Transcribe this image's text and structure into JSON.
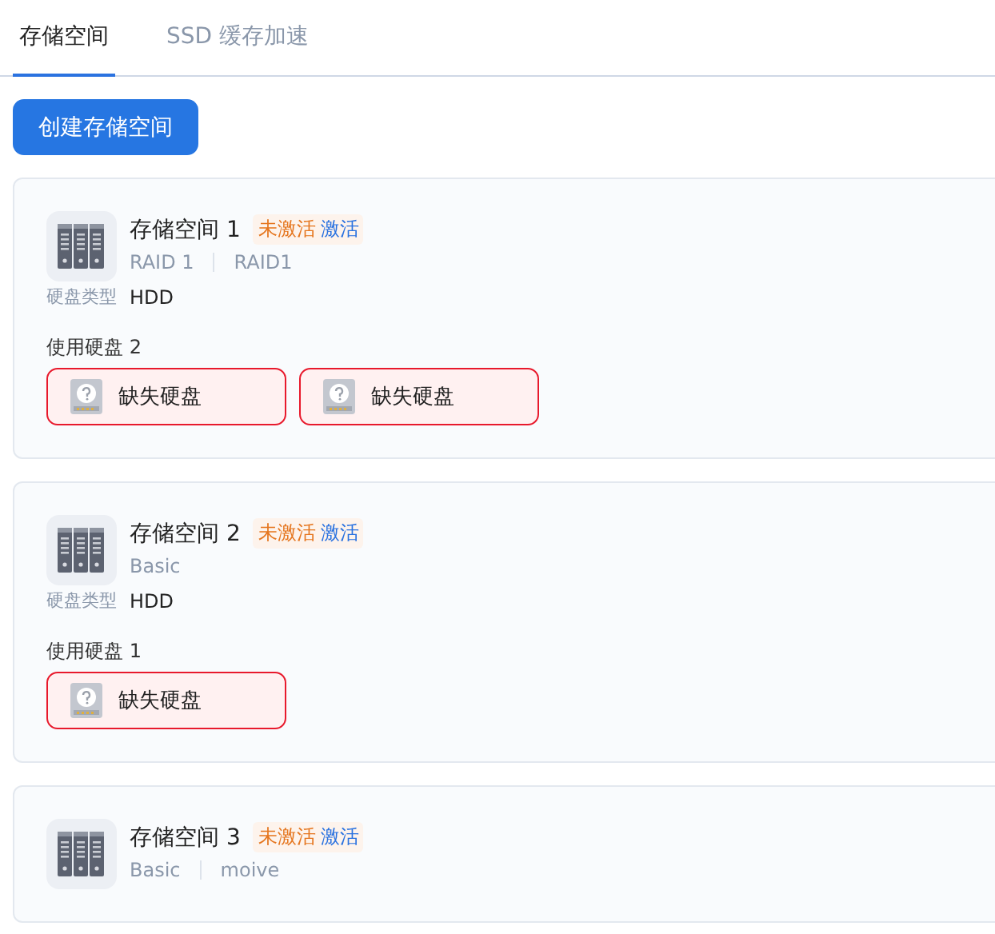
{
  "tabs": [
    {
      "label": "存储空间",
      "selected": true
    },
    {
      "label": "SSD 缓存加速",
      "selected": false
    }
  ],
  "create_button": "创建存储空间",
  "spaces": [
    {
      "name": "存储空间 1",
      "status": "未激活",
      "action": "激活",
      "tags": [
        "RAID 1",
        "RAID1"
      ],
      "disk_type_label": "硬盘类型",
      "disk_type": "HDD",
      "disks_label": "使用硬盘 2",
      "disks": [
        {
          "label": "缺失硬盘",
          "missing": true
        },
        {
          "label": "缺失硬盘",
          "missing": true
        }
      ]
    },
    {
      "name": "存储空间 2",
      "status": "未激活",
      "action": "激活",
      "tags": [
        "Basic"
      ],
      "disk_type_label": "硬盘类型",
      "disk_type": "HDD",
      "disks_label": "使用硬盘 1",
      "disks": [
        {
          "label": "缺失硬盘",
          "missing": true
        }
      ]
    },
    {
      "name": "存储空间 3",
      "status": "未激活",
      "action": "激活",
      "tags": [
        "Basic",
        "moive"
      ]
    }
  ]
}
